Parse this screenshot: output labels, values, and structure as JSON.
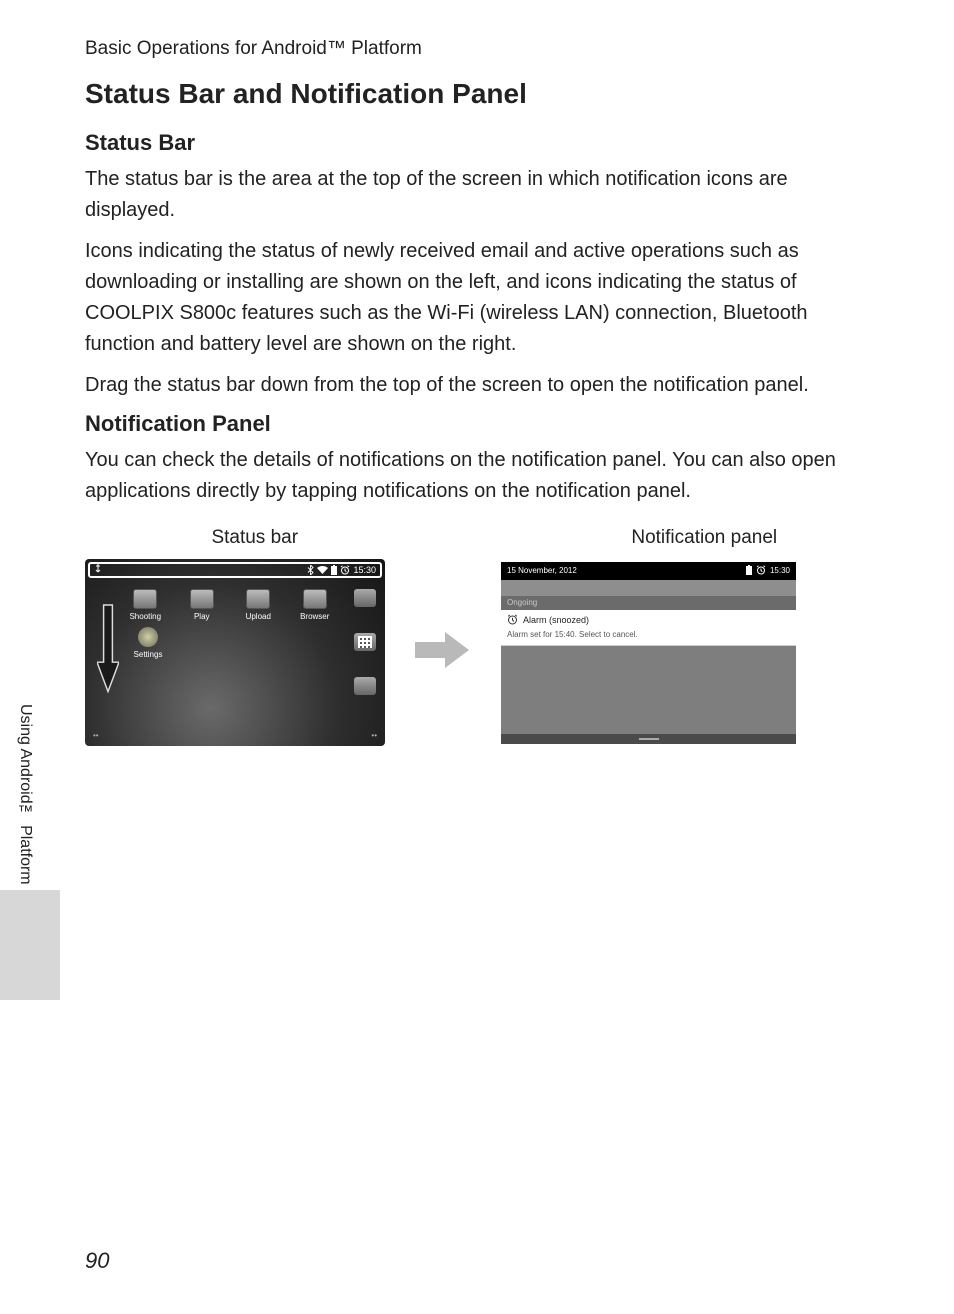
{
  "running_head": "Basic Operations for Android™ Platform",
  "title": "Status Bar and Notification Panel",
  "sections": {
    "status_bar": {
      "heading": "Status Bar",
      "p1": "The status bar is the area at the top of the screen in which notification icons are displayed.",
      "p2": "Icons indicating the status of newly received email and active operations such as downloading or installing are shown on the left, and icons indicating the status of COOLPIX S800c features such as the Wi-Fi (wireless LAN) connection, Bluetooth function and battery level are shown on the right.",
      "p3": "Drag the status bar down from the top of the screen to open the notification panel."
    },
    "notif_panel": {
      "heading": "Notification Panel",
      "p1": "You can check the details of notifications on the notification panel. You can also open applications directly by tapping notifications on the notification panel."
    }
  },
  "captions": {
    "left": "Status bar",
    "right": "Notification panel"
  },
  "fig1": {
    "time": "15:30",
    "apps": {
      "shooting": "Shooting",
      "play": "Play",
      "upload": "Upload",
      "browser": "Browser",
      "settings": "Settings"
    }
  },
  "fig2": {
    "date": "15 November, 2012",
    "time": "15:30",
    "ongoing_label": "Ongoing",
    "notif_title": "Alarm (snoozed)",
    "notif_sub": "Alarm set for 15:40. Select to cancel."
  },
  "side_tab": "Using Android™ Platform",
  "page_number": "90"
}
